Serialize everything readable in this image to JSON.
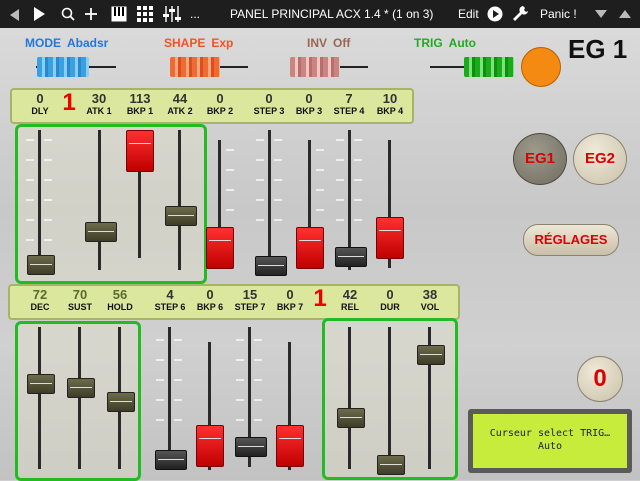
{
  "topbar": {
    "title": "PANEL PRINCIPAL ACX 1.4 * (1 on 3)",
    "ellipsis": "...",
    "edit_label": "Edit",
    "panic_label": "Panic !"
  },
  "header": {
    "mode": {
      "label": "MODE",
      "value": "Abadsr",
      "color": "#2277dd"
    },
    "shape": {
      "label": "SHAPE",
      "value": "Exp",
      "color": "#ee5522"
    },
    "inv": {
      "label": "INV",
      "value": "Off",
      "color": "#996655"
    },
    "trig": {
      "label": "TRIG",
      "value": "Auto",
      "color": "#22aa22"
    },
    "title": "EG 1"
  },
  "row1": [
    {
      "value": "0",
      "label": "DLY"
    },
    {
      "value": "1",
      "label": ""
    },
    {
      "value": "30",
      "label": "ATK 1"
    },
    {
      "value": "113",
      "label": "BKP 1"
    },
    {
      "value": "44",
      "label": "ATK 2"
    },
    {
      "value": "0",
      "label": "BKP 2"
    },
    {
      "value": "0",
      "label": "STEP 3"
    },
    {
      "value": "0",
      "label": "BKP 3"
    },
    {
      "value": "7",
      "label": "STEP 4"
    },
    {
      "value": "10",
      "label": "BKP 4"
    }
  ],
  "row2": [
    {
      "value": "72",
      "label": "DEC"
    },
    {
      "value": "70",
      "label": "SUST"
    },
    {
      "value": "56",
      "label": "HOLD"
    },
    {
      "value": "4",
      "label": "STEP 6"
    },
    {
      "value": "0",
      "label": "BKP 6"
    },
    {
      "value": "15",
      "label": "STEP 7"
    },
    {
      "value": "0",
      "label": "BKP 7"
    },
    {
      "value": "1",
      "label": ""
    },
    {
      "value": "42",
      "label": "REL"
    },
    {
      "value": "0",
      "label": "DUR"
    },
    {
      "value": "38",
      "label": "VOL"
    }
  ],
  "buttons": {
    "eg1": "EG1",
    "eg2": "EG2",
    "reglages": "RÉGLAGES",
    "counter": "0"
  },
  "lcd": {
    "line1": "Curseur select TRIG…",
    "line2": "Auto"
  },
  "colors": {
    "accent_red": "#e00000",
    "valrow_bg": "#dbe79c",
    "group_border": "#22bb22",
    "lcd_bg": "#c8ec3c",
    "orange": "#f58a12"
  }
}
